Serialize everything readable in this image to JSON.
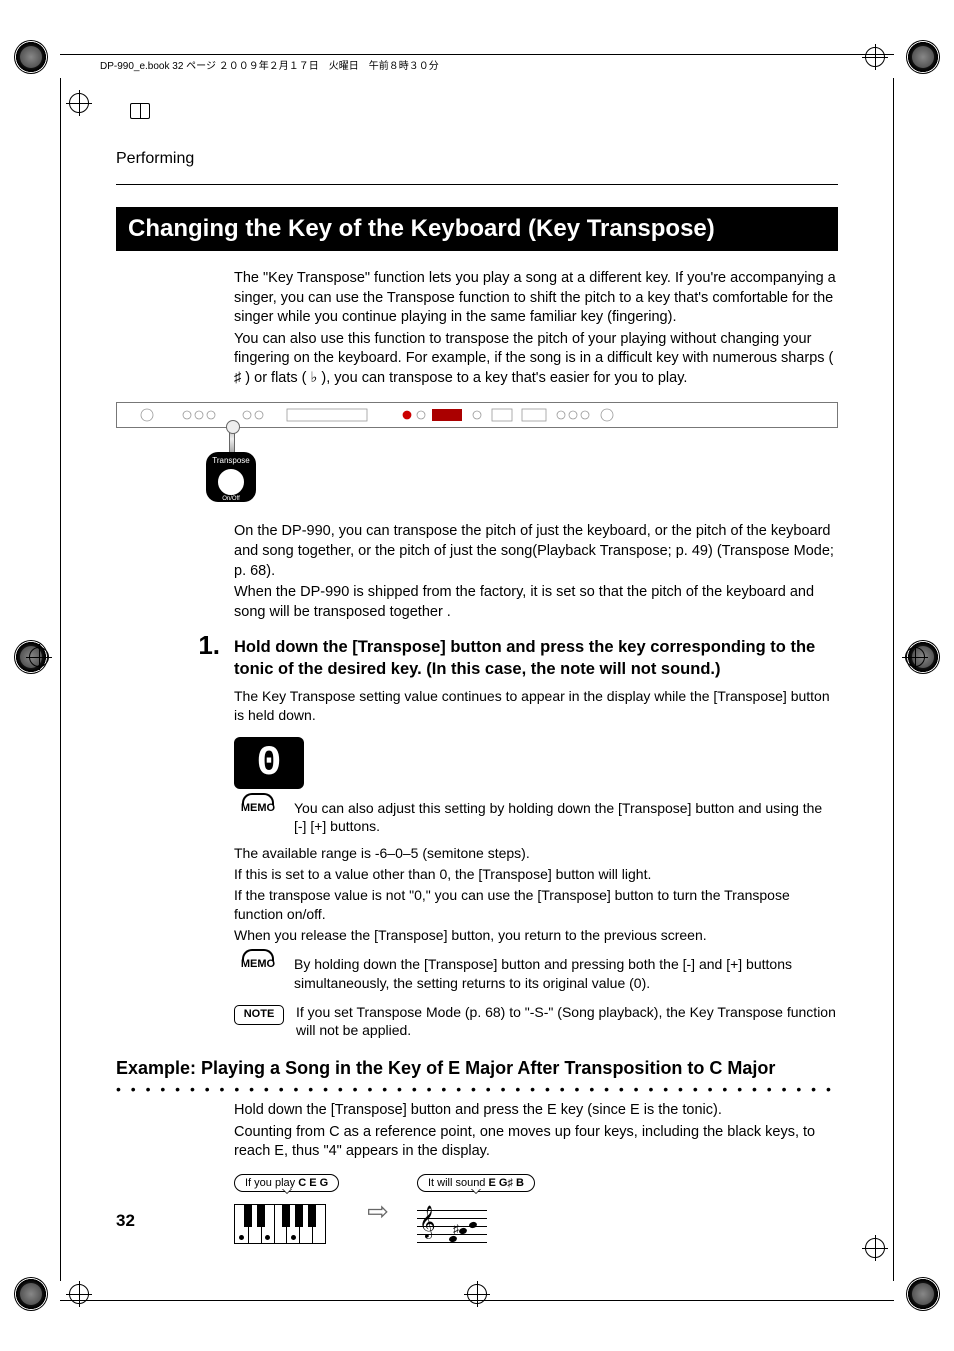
{
  "header_meta": "DP-990_e.book  32 ページ  ２００９年２月１７日　火曜日　午前８時３０分",
  "section_label": "Performing",
  "heading": "Changing the Key of the Keyboard (Key Transpose)",
  "intro_p1": "The \"Key Transpose\" function lets you play a song at a different key. If you're accompanying a singer, you can use the Transpose function to shift the pitch to a key that's comfortable for the singer while you continue playing in the same familiar key (fingering).",
  "intro_p2": "You can also use this function to transpose the pitch of your playing without changing your fingering on the keyboard. For example, if the song is in a difficult key with numerous sharps ( ♯ ) or flats ( ♭ ), you can transpose to a key that's easier for you to play.",
  "panel": {
    "callout_label": "Transpose",
    "callout_sub": "On/Off"
  },
  "after_panel_p1": "On the DP-990, you can transpose the pitch of just the keyboard, or the pitch of the keyboard and song together, or the pitch of just the song(Playback Transpose; p. 49) (Transpose Mode; p. 68).",
  "after_panel_p2": "When the DP-990 is shipped from the factory, it is set so that the pitch of the keyboard and song will be transposed together .",
  "step1_num": "1.",
  "step1_text": "Hold down the [Transpose] button and press the key corresponding to the tonic of the desired key. (In this case, the note will not sound.)",
  "step1_sub": "The Key Transpose setting value continues to appear in the display while the [Transpose] button is held down.",
  "display_value": "0",
  "memo1_label": "MEMO",
  "memo1_text": "You can also adjust this setting by holding down the [Transpose] button and using the [-] [+] buttons.",
  "range_line": "The available range is -6–0–5 (semitone steps).",
  "light_line": "If this is set to a value other than 0, the [Transpose] button will light.",
  "onoff_line": "If the transpose value is not \"0,\" you can use the [Transpose] button to turn the Transpose function on/off.",
  "release_line": "When you release the [Transpose] button, you return to the previous screen.",
  "memo2_label": "MEMO",
  "memo2_text": "By holding down the [Transpose] button and pressing both the [-] and [+] buttons simultaneously, the setting returns to its original value (0).",
  "note_label": "NOTE",
  "note_text": "If you set Transpose Mode (p. 68) to \"-S-\" (Song playback), the Key Transpose function will not be applied.",
  "example_heading": "Example: Playing a Song in the Key of E Major After Transposition to C Major",
  "example_p1": "Hold down the [Transpose] button and press the E key (since E is the tonic).",
  "example_p2": "Counting from C as a reference point, one moves up four keys, including the black keys, to reach E, thus \"4\" appears in the display.",
  "bubble_play_prefix": "If you play ",
  "bubble_play_notes": "C E G",
  "bubble_sound_prefix": "It will sound ",
  "bubble_sound_notes": "E G♯ B",
  "page_number": "32"
}
